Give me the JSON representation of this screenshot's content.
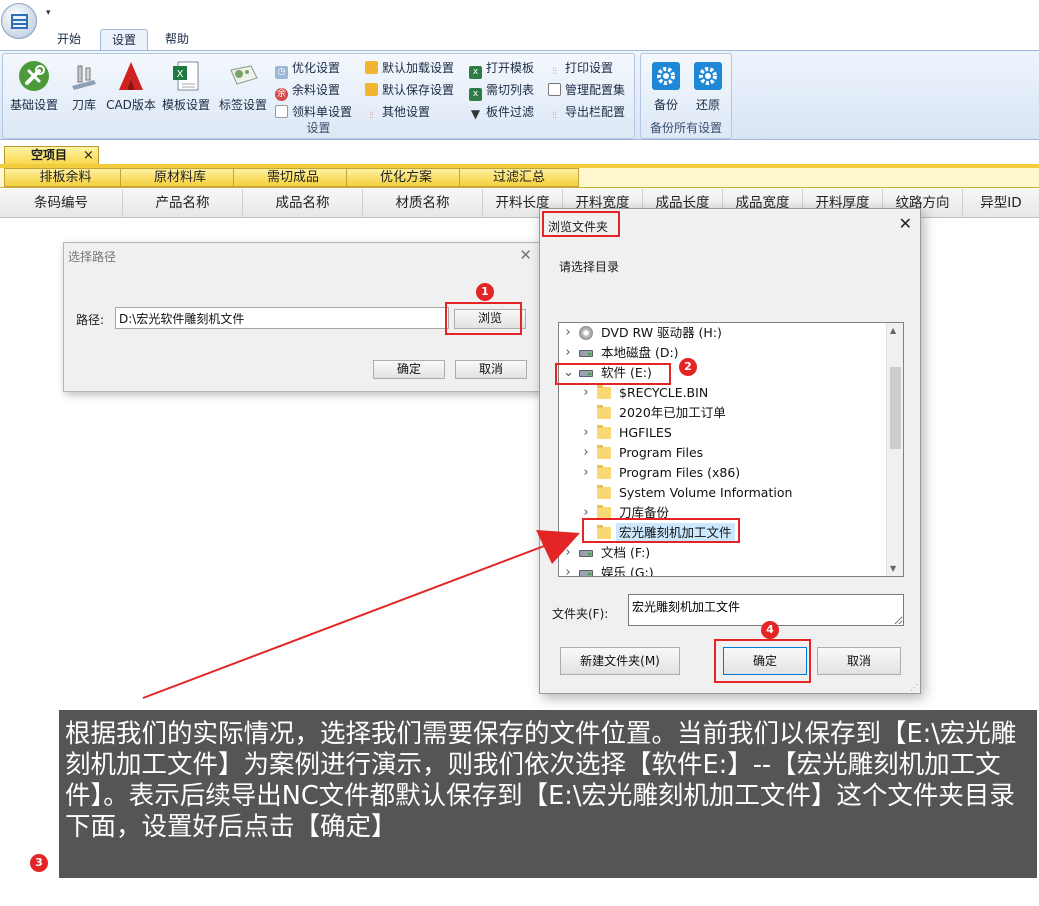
{
  "ribbon": {
    "tabs": [
      "开始",
      "设置",
      "帮助"
    ],
    "active_tab": "设置",
    "big_buttons": [
      "基础设置",
      "刀库",
      "CAD版本",
      "模板设置",
      "标签设置"
    ],
    "col1": [
      "优化设置",
      "余料设置",
      "领料单设置"
    ],
    "col2": [
      "默认加载设置",
      "默认保存设置",
      "其他设置"
    ],
    "col3": [
      "打开模板",
      "需切列表",
      "板件过滤"
    ],
    "col4": [
      "打印设置",
      "管理配置集",
      "导出栏配置"
    ],
    "group1_label": "设置",
    "backup_buttons": [
      "备份",
      "还原"
    ],
    "group2_label": "备份所有设置"
  },
  "project": {
    "tab_label": "空项目",
    "close": "×",
    "sub_tabs": [
      "排板余料",
      "原材料库",
      "需切成品",
      "优化方案",
      "过滤汇总"
    ],
    "columns": [
      "条码编号",
      "产品名称",
      "成品名称",
      "材质名称",
      "开料长度",
      "开料宽度",
      "成品长度",
      "成品宽度",
      "开料厚度",
      "纹路方向",
      "异型ID"
    ]
  },
  "path_dialog": {
    "title": "选择路径",
    "close": "✕",
    "path_label": "路径:",
    "path_value": "D:\\宏光软件雕刻机文件",
    "browse": "浏览",
    "ok": "确定",
    "cancel": "取消"
  },
  "browse_dialog": {
    "title": "浏览文件夹",
    "close": "✕",
    "prompt": "请选择目录",
    "tree": [
      {
        "label": "DVD RW 驱动器 (H:)",
        "level": 0,
        "expander": ">",
        "icon": "disc"
      },
      {
        "label": "本地磁盘 (D:)",
        "level": 0,
        "expander": ">",
        "icon": "drive"
      },
      {
        "label": "软件 (E:)",
        "level": 0,
        "expander": "v",
        "icon": "drive"
      },
      {
        "label": "$RECYCLE.BIN",
        "level": 1,
        "expander": ">",
        "icon": "folder"
      },
      {
        "label": "2020年已加工订单",
        "level": 1,
        "expander": "",
        "icon": "folder"
      },
      {
        "label": "HGFILES",
        "level": 1,
        "expander": ">",
        "icon": "folder"
      },
      {
        "label": "Program Files",
        "level": 1,
        "expander": ">",
        "icon": "folder"
      },
      {
        "label": "Program Files (x86)",
        "level": 1,
        "expander": ">",
        "icon": "folder"
      },
      {
        "label": "System Volume Information",
        "level": 1,
        "expander": "",
        "icon": "folder"
      },
      {
        "label": "刀库备份",
        "level": 1,
        "expander": ">",
        "icon": "folder"
      },
      {
        "label": "宏光雕刻机加工文件",
        "level": 1,
        "expander": "",
        "icon": "folder",
        "selected": true
      },
      {
        "label": "文档 (F:)",
        "level": 0,
        "expander": ">",
        "icon": "drive"
      },
      {
        "label": "娱乐 (G:)",
        "level": 0,
        "expander": ">",
        "icon": "drive"
      }
    ],
    "folder_label": "文件夹(F):",
    "folder_value": "宏光雕刻机加工文件",
    "new_folder": "新建文件夹(M)",
    "ok": "确定",
    "cancel": "取消"
  },
  "annotations": {
    "badges": [
      "1",
      "2",
      "3",
      "4"
    ],
    "caption": "根据我们的实际情况，选择我们需要保存的文件位置。当前我们以保存到【E:\\宏光雕刻机加工文件】为案例进行演示，则我们依次选择【软件E:】--【宏光雕刻机加工文件】。表示后续导出NC文件都默认保存到【E:\\宏光雕刻机加工文件】这个文件夹目录下面，设置好后点击【确定】",
    "highlight_color": "#e32525"
  }
}
